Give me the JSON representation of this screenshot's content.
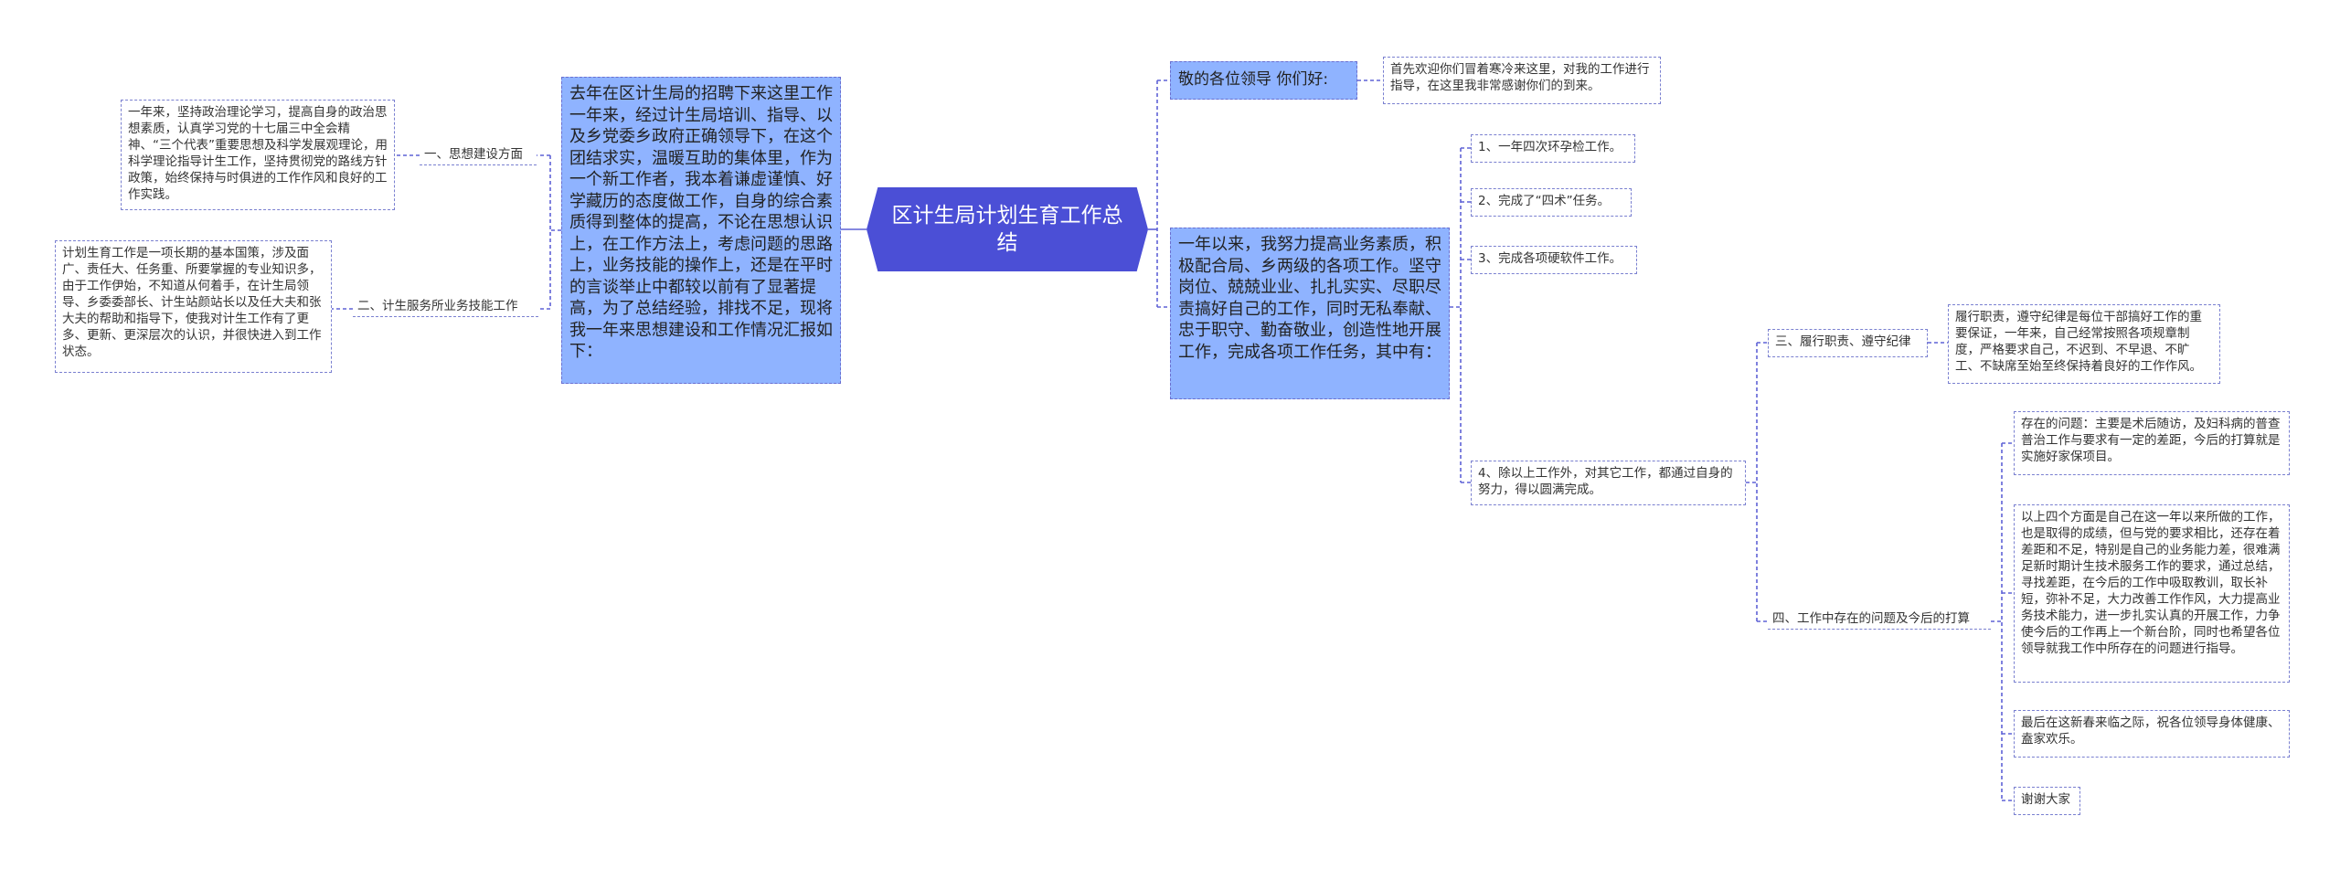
{
  "root": {
    "title": "区计生局计划生育工作总结"
  },
  "left": {
    "intro": "去年在区计生局的招聘下来这里工作一年来，经过计生局培训、指导、以及乡党委乡政府正确领导下，在这个团结求实，温暖互助的集体里，作为一个新工作者，我本着谦虚谨慎、好学藏历的态度做工作，自身的综合素质得到整体的提高，不论在思想认识上，在工作方法上，考虑问题的思路上，业务技能的操作上，还是在平时的言谈举止中都较以前有了显著提高，为了总结经验，排找不足，现将我一年来思想建设和工作情况汇报如下：",
    "section1": {
      "label": "一、思想建设方面",
      "text": "一年来，坚持政治理论学习，提高自身的政治思想素质，认真学习党的十七届三中全会精神、“三个代表”重要思想及科学发展观理论，用科学理论指导计生工作，坚持贯彻党的路线方针政策，始终保持与时俱进的工作作风和良好的工作实践。"
    },
    "section2": {
      "label": "二、计生服务所业务技能工作",
      "text": "计划生育工作是一项长期的基本国策，涉及面广、责任大、任务重、所要掌握的专业知识多，由于工作伊始，不知道从何着手，在计生局领导、乡委委部长、计生站颜站长以及任大夫和张大夫的帮助和指导下，使我对计生工作有了更多、更新、更深层次的认识，并很快进入到工作状态。"
    }
  },
  "right": {
    "greeting": {
      "label": "敬的各位领导 你们好:",
      "text": "首先欢迎你们冒着寒冷来这里，对我的工作进行指导，在这里我非常感谢你们的到来。"
    },
    "work": {
      "text": "一年以来，我努力提高业务素质，积极配合局、乡两级的各项工作。坚守岗位、兢兢业业、扎扎实实、尽职尽责搞好自己的工作，同时无私奉献、忠于职守、勤奋敬业，创造性地开展工作，完成各项工作任务，其中有：",
      "items": [
        "1、一年四次环孕检工作。",
        "2、完成了“四术”任务。",
        "3、完成各项硬软件工作。",
        "4、除以上工作外，对其它工作，都通过自身的努力，得以圆满完成。"
      ]
    },
    "section3": {
      "label": "三、履行职责、遵守纪律",
      "text": "履行职责，遵守纪律是每位干部搞好工作的重要保证，一年来，自己经常按照各项规章制度，严格要求自己，不迟到、不早退、不旷工、不缺席至始至终保持着良好的工作作风。"
    },
    "section4": {
      "label": "四、工作中存在的问题及今后的打算",
      "items": [
        "存在的问题：主要是术后随访，及妇科病的普查普治工作与要求有一定的差距，今后的打算就是实施好家保项目。",
        "以上四个方面是自己在这一年以来所做的工作，也是取得的成绩，但与党的要求相比，还存在着差距和不足，特别是自己的业务能力差，很难满足新时期计生技术服务工作的要求，通过总结，寻找差距，在今后的工作中吸取教训，取长补短，弥补不足，大力改善工作作风，大力提高业务技术能力，进一步扎实认真的开展工作，力争使今后的工作再上一个新台阶，同时也希望各位领导就我工作中所存在的问题进行指导。",
        "最后在这新春来临之际，祝各位领导身体健康、盍家欢乐。",
        "谢谢大家"
      ]
    }
  },
  "colors": {
    "root": "#4b4fd6",
    "main": "#8fb3ff",
    "line": "#5f62d6",
    "border": "#7a80d0"
  }
}
